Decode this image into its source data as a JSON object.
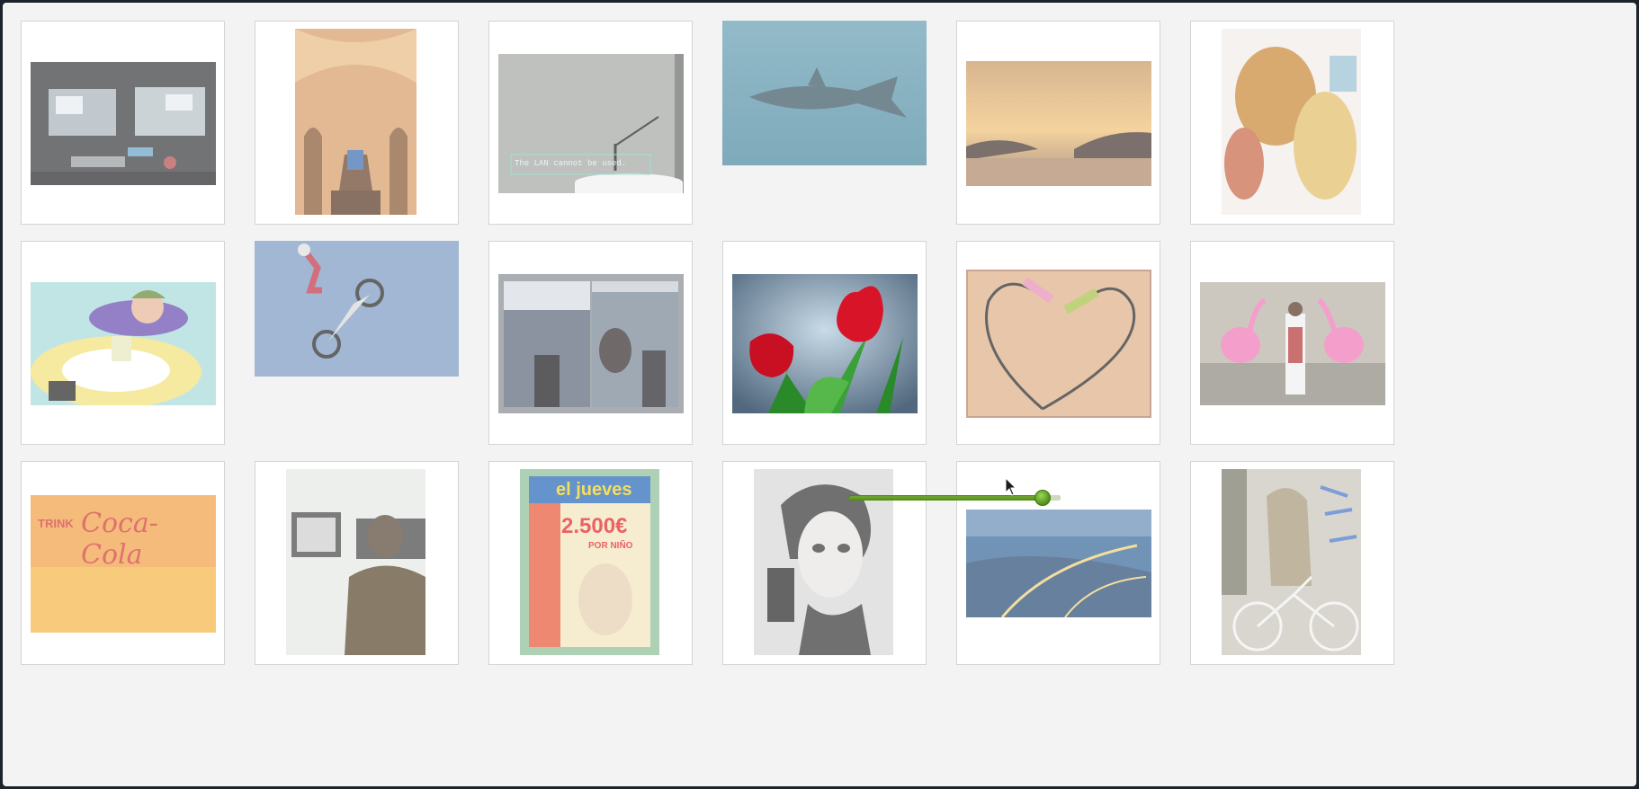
{
  "gallery": {
    "tiles": [
      {
        "name": "photo-workstation"
      },
      {
        "name": "photo-cathedral"
      },
      {
        "name": "photo-podium"
      },
      {
        "name": "photo-shark"
      },
      {
        "name": "photo-sunset"
      },
      {
        "name": "photo-yarn"
      },
      {
        "name": "photo-child-pool"
      },
      {
        "name": "photo-motocross"
      },
      {
        "name": "photo-magazine-spread"
      },
      {
        "name": "photo-tulips"
      },
      {
        "name": "photo-cable-heart"
      },
      {
        "name": "photo-flamingos"
      },
      {
        "name": "photo-coca-cola"
      },
      {
        "name": "photo-gallery-visitor"
      },
      {
        "name": "photo-el-jueves"
      },
      {
        "name": "photo-portrait"
      },
      {
        "name": "photo-city-night"
      },
      {
        "name": "photo-bicycle-mural"
      }
    ],
    "podium_caption": "The LAN cannot be used.",
    "coca_cola": {
      "prefix": "TRINK",
      "brand": "Coca-Cola"
    },
    "magazine": {
      "title": "el jueves",
      "price": "2.500€",
      "tagline": "POR NIÑO"
    },
    "slider": {
      "value": 0.95
    },
    "colors": {
      "background": "#f3f3f3",
      "card": "#ffffff",
      "slider_fill": "#5a9b1c"
    }
  }
}
